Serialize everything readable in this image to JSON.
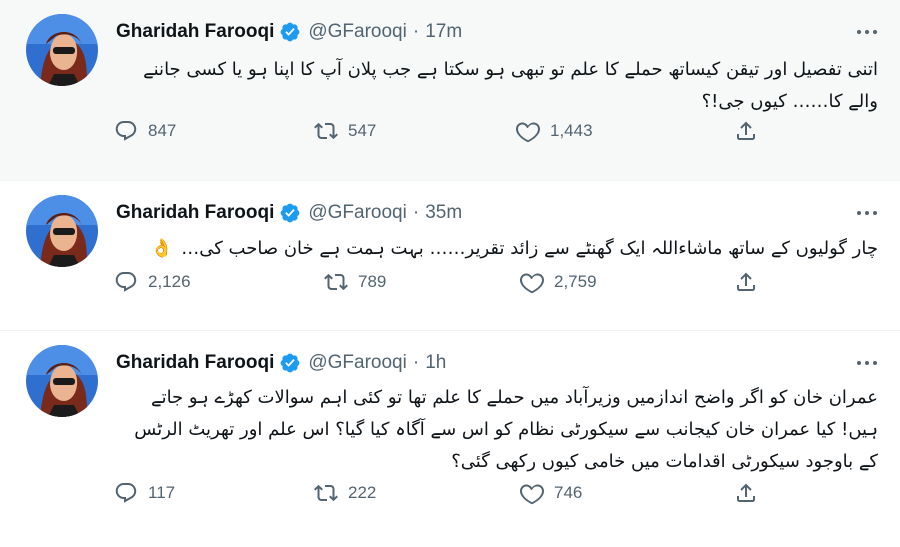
{
  "tweets": [
    {
      "author": "Gharidah Farooqi",
      "handle": "@GFarooqi",
      "separator": "·",
      "time": "17m",
      "lines": [
        "اتنی تفصیل اور تیقن کیساتھ حملے کا علم تو تبھی ہو سکتا ہے جب پلان آپ کا اپنا ہو یا کسی جاننے",
        "والے کا…… کیوں جی!؟"
      ],
      "replies": "847",
      "retweets": "547",
      "likes": "1,443"
    },
    {
      "author": "Gharidah Farooqi",
      "handle": "@GFarooqi",
      "separator": "·",
      "time": "35m",
      "lines": [
        "چار گولیوں کے ساتھ ماشاءاللہ ایک گھنٹے سے زائد تقریر…… بہت ہمت ہے خان صاحب کی…"
      ],
      "emoji": "👌",
      "replies": "2,126",
      "retweets": "789",
      "likes": "2,759"
    },
    {
      "author": "Gharidah Farooqi",
      "handle": "@GFarooqi",
      "separator": "·",
      "time": "1h",
      "lines": [
        "عمران خان کو اگر واضح اندازمیں وزیرآباد میں حملے کا علم تھا تو کئی اہم سوالات کھڑے ہو جاتے",
        "ہیں! کیا عمران خان کیجانب سے سیکورٹی نظام کو اس سے آگاہ کیا گیا؟ اس علم اور تھریٹ الرٹس",
        "کے باوجود سیکورٹی اقدامات میں خامی کیوں رکھی گئی؟"
      ],
      "replies": "117",
      "retweets": "222",
      "likes": "746"
    }
  ],
  "icons": {
    "verified_color": "#1d9bf0",
    "action_color": "#536471"
  }
}
